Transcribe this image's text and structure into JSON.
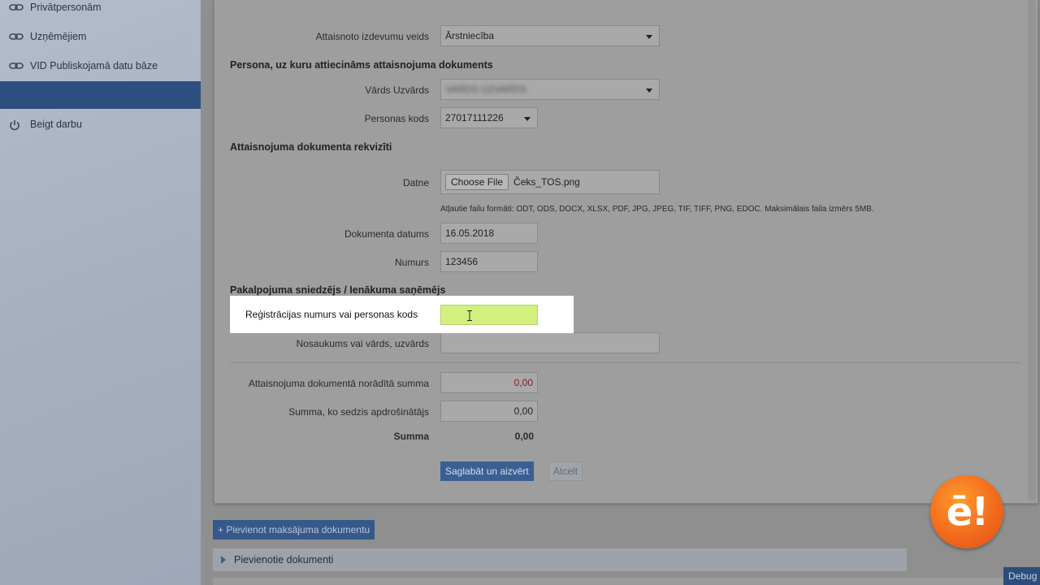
{
  "sidebar": {
    "items": [
      {
        "label": "Privātpersonām",
        "icon": "link-icon"
      },
      {
        "label": "Uzņēmējiem",
        "icon": "link-icon"
      },
      {
        "label": "VID Publiskojamā datu bāze",
        "icon": "link-icon"
      },
      {
        "label": "",
        "active": true
      },
      {
        "label": "Beigt darbu",
        "icon": "power-icon"
      }
    ]
  },
  "form": {
    "expense_type_label": "Attaisnoto izdevumu veids",
    "expense_type_value": "Ārstniecība",
    "person_section": "Persona, uz kuru attiecināms attaisnojuma dokuments",
    "name_label": "Vārds Uzvārds",
    "name_value": "VARDS UZVARDS",
    "personal_code_label": "Personas kods",
    "personal_code_value": "27017111226",
    "doc_section": "Attaisnojuma dokumenta rekvizīti",
    "file_label": "Datne",
    "file_button": "Choose File",
    "file_name": "Čeks_TOS.png",
    "file_hint": "Atļautie failu formāti: ODT, ODS, DOCX, XLSX, PDF, JPG, JPEG, TIF, TIFF, PNG, EDOC. Maksimālais faila izmērs 5MB.",
    "doc_date_label": "Dokumenta datums",
    "doc_date_value": "16.05.2018",
    "number_label": "Numurs",
    "number_value": "123456",
    "provider_section": "Pakalpojuma sniedzējs / Ienākuma saņēmējs",
    "reg_label": "Reģistrācijas numurs vai personas kods",
    "reg_value": "",
    "provider_name_label": "Nosaukums vai vārds, uzvārds",
    "provider_name_value": "",
    "doc_sum_label": "Attaisnojuma dokumentā norādītā summa",
    "doc_sum_value": "0,00",
    "insurer_sum_label": "Summa, ko sedzis apdrošinātājs",
    "insurer_sum_value": "0,00",
    "total_label": "Summa",
    "total_value": "0,00",
    "save_button": "Saglabāt un aizvērt",
    "cancel_button": "Atcelt"
  },
  "footer": {
    "add_payment_button": "+ Pievienot maksājuma dokumentu",
    "attached_docs": "Pievienotie dokumenti",
    "debug_button": "Debug"
  },
  "logo": {
    "text": "ē!"
  },
  "colors": {
    "sidebar_active": "#2d4f7f",
    "primary_button": "#3a5f93",
    "highlight_input": "#d2f07e",
    "logo_orange": "#f26b1d"
  }
}
